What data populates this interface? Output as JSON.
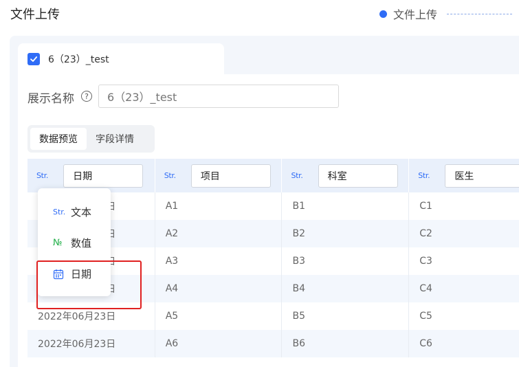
{
  "header": {
    "title": "文件上传",
    "step_label": "文件上传"
  },
  "colors": {
    "accent": "#2f6cf6",
    "number_tag": "#23b04a",
    "highlight": "#e02020"
  },
  "tab": {
    "label": "6（23）_test",
    "checked": true
  },
  "form": {
    "display_name_label": "展示名称",
    "help_icon_text": "?",
    "display_name_value": "6（23）_test"
  },
  "segment": {
    "items": [
      "数据预览",
      "字段详情"
    ],
    "active": "数据预览"
  },
  "table": {
    "type_tag": "Str.",
    "columns": [
      "日期",
      "项目",
      "科室",
      "医生"
    ],
    "rows": [
      [
        "2022年06月23日",
        "A1",
        "B1",
        "C1"
      ],
      [
        "2022年06月23日",
        "A2",
        "B2",
        "C2"
      ],
      [
        "2022年06月23日",
        "A3",
        "B3",
        "C3"
      ],
      [
        "2022年06月23日",
        "A4",
        "B4",
        "C4"
      ],
      [
        "2022年06月23日",
        "A5",
        "B5",
        "C5"
      ],
      [
        "2022年06月23日",
        "A6",
        "B6",
        "C6"
      ]
    ]
  },
  "type_dropdown": {
    "items": [
      {
        "tag": "Str.",
        "label": "文本",
        "icon": "str-icon"
      },
      {
        "tag": "№",
        "label": "数值",
        "icon": "number-icon"
      },
      {
        "tag": "",
        "label": "日期",
        "icon": "calendar-icon"
      }
    ],
    "highlighted": "日期"
  }
}
